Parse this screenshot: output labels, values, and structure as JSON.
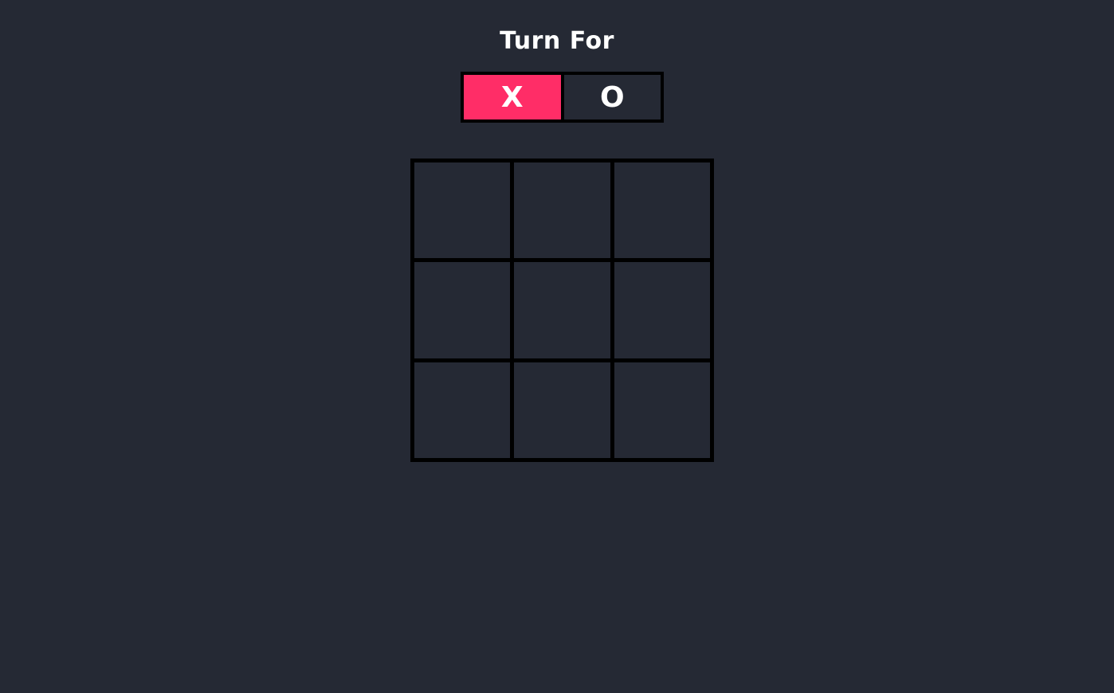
{
  "header": {
    "title": "Turn For"
  },
  "turn": {
    "options": [
      "X",
      "O"
    ],
    "active": "X"
  },
  "colors": {
    "background": "#252934",
    "active_turn": "#ff2d67",
    "grid_lines": "#000000",
    "text": "#ffffff"
  },
  "board": {
    "cells": [
      "",
      "",
      "",
      "",
      "",
      "",
      "",
      "",
      ""
    ]
  }
}
